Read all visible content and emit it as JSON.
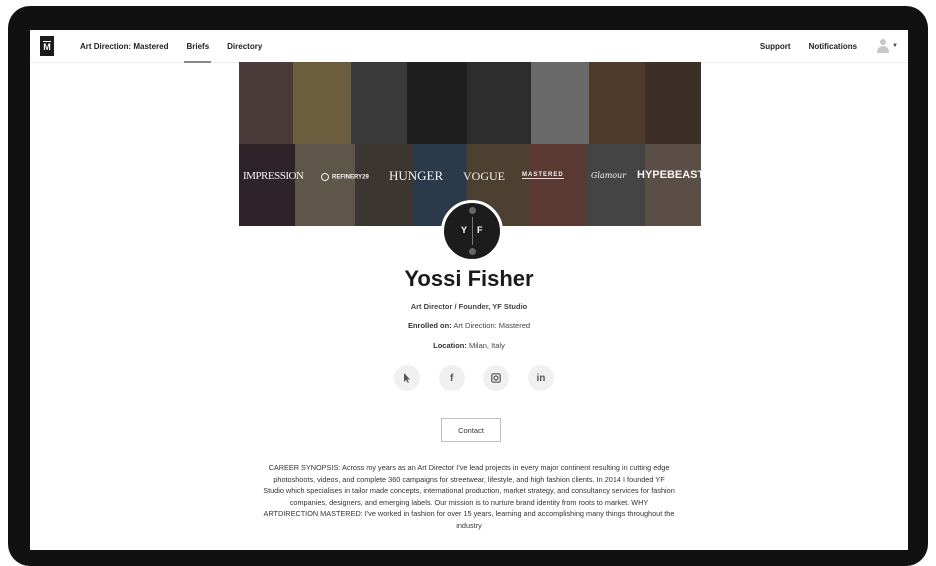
{
  "nav": {
    "logo": "M",
    "links": [
      "Art Direction: Mastered",
      "Briefs",
      "Directory"
    ],
    "right_links": [
      "Support",
      "Notifications"
    ]
  },
  "banner": {
    "brands": [
      "IMPRESSION",
      "REFINERY29",
      "HUNGER",
      "VOGUE",
      "MASTERED",
      "Glamour",
      "HYPEBEAST"
    ]
  },
  "profile": {
    "initials_left": "Y",
    "initials_right": "F",
    "name": "Yossi Fisher",
    "role": "Art Director / Founder, YF Studio",
    "enrolled_label": "Enrolled on:",
    "enrolled_value": "Art Direction: Mastered",
    "location_label": "Location:",
    "location_value": "Milan, Italy",
    "socials": [
      "cursor-icon",
      "facebook-icon",
      "instagram-icon",
      "linkedin-icon"
    ],
    "linkedin_text": "in",
    "facebook_text": "f",
    "contact_label": "Contact",
    "bio": "CAREER SYNOPSIS: Across my years as an Art Director I've lead projects in every major continent resulting in cutting edge photoshoots, videos, and complete 360 campaigns for streetwear, lifestyle, and high fashion clients. In 2014 I founded YF Studio which specialises in tailor made concepts, international production, market strategy, and consultancy services for fashion companies, designers, and emerging labels. Our mission is to nurture brand identity from roots to market. WHY ARTDIRECTION MASTERED: I've worked in fashion for over 15 years, learning and accomplishing many things throughout the industry"
  },
  "colors": {
    "bezel": "#111111",
    "text": "#1a1a1a",
    "social_bg": "#f0f0f0"
  }
}
